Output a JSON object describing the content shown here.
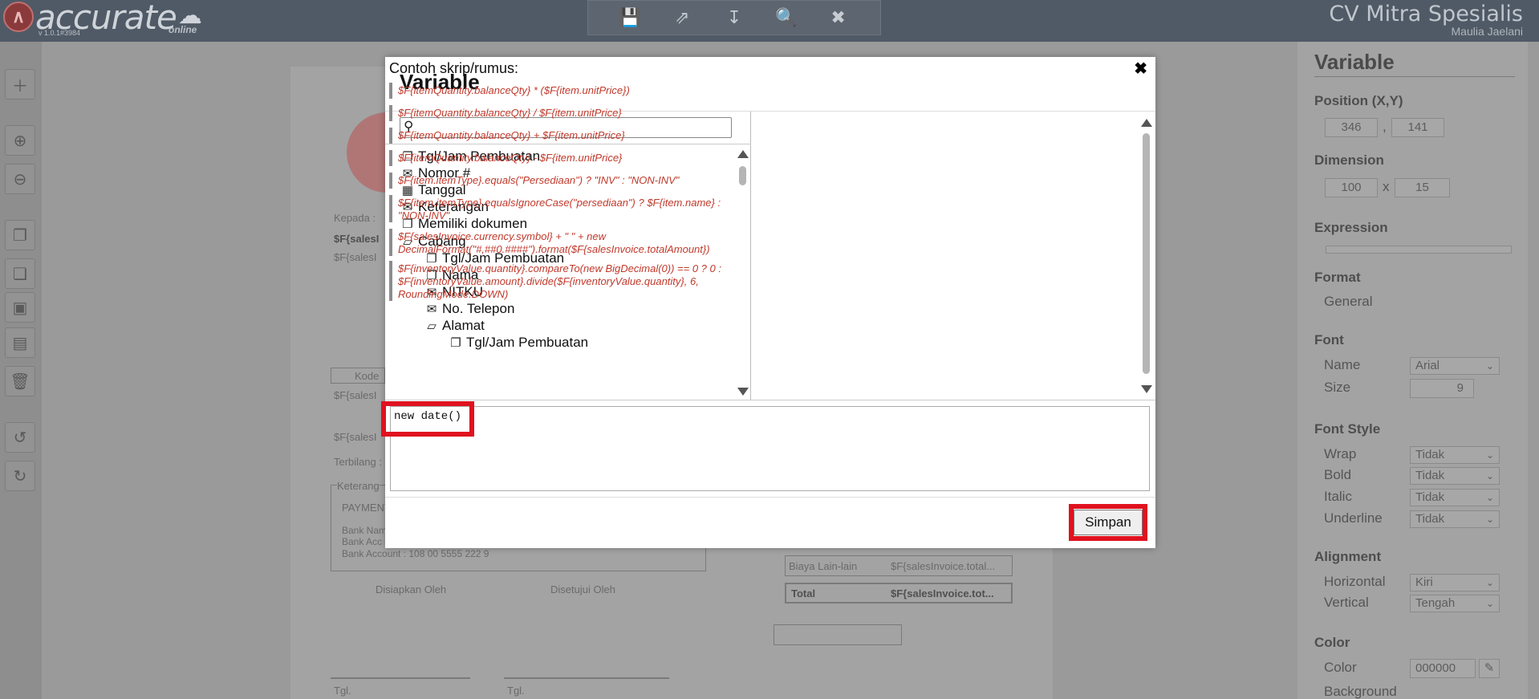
{
  "app": {
    "logo_text": "accurate",
    "logo_sub": "online",
    "version": "v 1.0.1#3984",
    "company": "CV Mitra Spesialis",
    "user": "Maulia Jaelani"
  },
  "toolbar": {
    "icons": [
      "save-icon",
      "export-icon",
      "import-icon",
      "preview-icon",
      "close-icon"
    ]
  },
  "leftbar": {
    "icons": [
      "add-icon",
      "zoom-in-icon",
      "zoom-out-icon",
      "copy-icon",
      "paste-icon",
      "bring-front-icon",
      "send-back-icon",
      "delete-icon",
      "undo-icon",
      "redo-icon"
    ]
  },
  "canvas": {
    "kepada": "Kepada :",
    "sales1": "$F{salesI",
    "sales2": "$F{salesI",
    "kode": "Kode",
    "sales3": "$F{salesI",
    "sales4": "$F{salesI",
    "terbilang": "Terbilang :",
    "keterangan": "Keterang",
    "payment": "PAYMENT",
    "bank_name": "Bank Nam",
    "bank_acc": "Bank Acc",
    "bank_account": "Bank Account : 108 00 5555 222 9",
    "disiapkan": "Disiapkan Oleh",
    "disetujui": "Disetujui Oleh",
    "biaya_lain": "Biaya Lain-lain",
    "biaya_value": "$F{salesInvoice.total...",
    "total": "Total",
    "total_value": "$F{salesInvoice.tot...",
    "tgl1": "Tgl.",
    "tgl2": "Tgl."
  },
  "properties": {
    "title": "Variable",
    "position_label": "Position (X,Y)",
    "pos_x": "346",
    "pos_sep": ",",
    "pos_y": "141",
    "dimension_label": "Dimension",
    "dim_w": "100",
    "dim_sep": "x",
    "dim_h": "15",
    "expression_label": "Expression",
    "format_label": "Format",
    "format_value": "General",
    "font_label": "Font",
    "font_name_label": "Name",
    "font_name_value": "Arial",
    "font_size_label": "Size",
    "font_size_value": "9",
    "font_style_label": "Font Style",
    "wrap_label": "Wrap",
    "wrap_value": "Tidak",
    "bold_label": "Bold",
    "bold_value": "Tidak",
    "italic_label": "Italic",
    "italic_value": "Tidak",
    "underline_label": "Underline",
    "underline_value": "Tidak",
    "alignment_label": "Alignment",
    "horizontal_label": "Horizontal",
    "horizontal_value": "Kiri",
    "vertical_label": "Vertical",
    "vertical_value": "Tengah",
    "color_label": "Color",
    "color_sub_label": "Color",
    "color_value": "000000",
    "background_label": "Background"
  },
  "dialog": {
    "title": "Variable",
    "search_placeholder": "",
    "tree": [
      {
        "icon": "file-icon",
        "label": "Tgl/Jam Pembuatan",
        "level": 0
      },
      {
        "icon": "comment-icon",
        "label": "Nomor #",
        "level": 0
      },
      {
        "icon": "calendar-icon",
        "label": "Tanggal",
        "level": 0
      },
      {
        "icon": "comment-icon",
        "label": "Keterangan",
        "level": 0
      },
      {
        "icon": "file-icon",
        "label": "Memiliki dokumen",
        "level": 0
      },
      {
        "icon": "folder-open-icon",
        "label": "Cabang",
        "level": 0
      },
      {
        "icon": "file-icon",
        "label": "Tgl/Jam Pembuatan",
        "level": 1
      },
      {
        "icon": "file-icon",
        "label": "Nama",
        "level": 1
      },
      {
        "icon": "comment-icon",
        "label": "NITKU",
        "level": 1
      },
      {
        "icon": "comment-icon",
        "label": "No. Telepon",
        "level": 1
      },
      {
        "icon": "folder-open-icon",
        "label": "Alamat",
        "level": 1
      },
      {
        "icon": "file-icon",
        "label": "Tgl/Jam Pembuatan",
        "level": 2
      }
    ],
    "examples_title": "Contoh skrip/rumus:",
    "examples": [
      "$F{itemQuantity.balanceQty} * ($F{item.unitPrice})",
      "$F{itemQuantity.balanceQty} / $F{item.unitPrice}",
      "$F{itemQuantity.balanceQty} + $F{item.unitPrice}",
      "$F{itemQuantity.balanceQty} - $F{item.unitPrice}",
      "$F{item.itemType}.equals(\"Persediaan\") ? \"INV\" : \"NON-INV\"",
      "$F{item.itemType}.equalsIgnoreCase(\"persediaan\") ? $F{item.name} : \"NON-INV\"",
      "$F{salesInvoice.currency.symbol} + \" \" + new DecimalFormat(\"#,##0.####\").format($F{salesInvoice.totalAmount})",
      "$F{inventoryValue.quantity}.compareTo(new BigDecimal(0)) == 0 ? 0 : $F{inventoryValue.amount}.divide($F{inventoryValue.quantity}, 6, RoundingMode.DOWN)"
    ],
    "expression_value": "new date()",
    "save_label": "Simpan"
  },
  "colors": {
    "topbar": "#505a66",
    "highlight": "#e0121f",
    "example_text": "#c0392b"
  }
}
